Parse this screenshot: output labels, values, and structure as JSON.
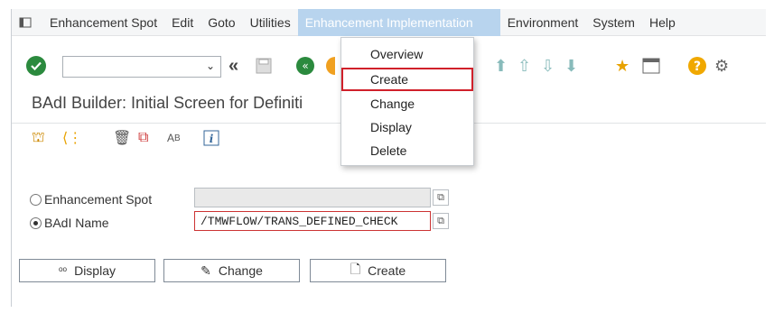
{
  "menubar": {
    "items": [
      {
        "label": "Enhancement Spot"
      },
      {
        "label": "Edit"
      },
      {
        "label": "Goto"
      },
      {
        "label": "Utilities"
      },
      {
        "label": "Enhancement Implementation"
      },
      {
        "label": "Environment"
      },
      {
        "label": "System"
      },
      {
        "label": "Help"
      }
    ]
  },
  "dropdown": {
    "items": [
      {
        "label": "Overview"
      },
      {
        "label": "Create"
      },
      {
        "label": "Change"
      },
      {
        "label": "Display"
      },
      {
        "label": "Delete"
      }
    ]
  },
  "page": {
    "title": "BAdI Builder: Initial Screen for Definiti"
  },
  "form": {
    "enh_spot_label": "Enhancement Spot",
    "enh_spot_value": "",
    "badi_label": "BAdI Name",
    "badi_value": "/TMWFLOW/TRANS_DEFINED_CHECK"
  },
  "buttons": {
    "display": "Display",
    "change": "Change",
    "create": "Create"
  },
  "colors": {
    "accent_active_menu": "#b8d4ee",
    "highlight": "#d0202a",
    "ok_green": "#2b8a3e"
  }
}
